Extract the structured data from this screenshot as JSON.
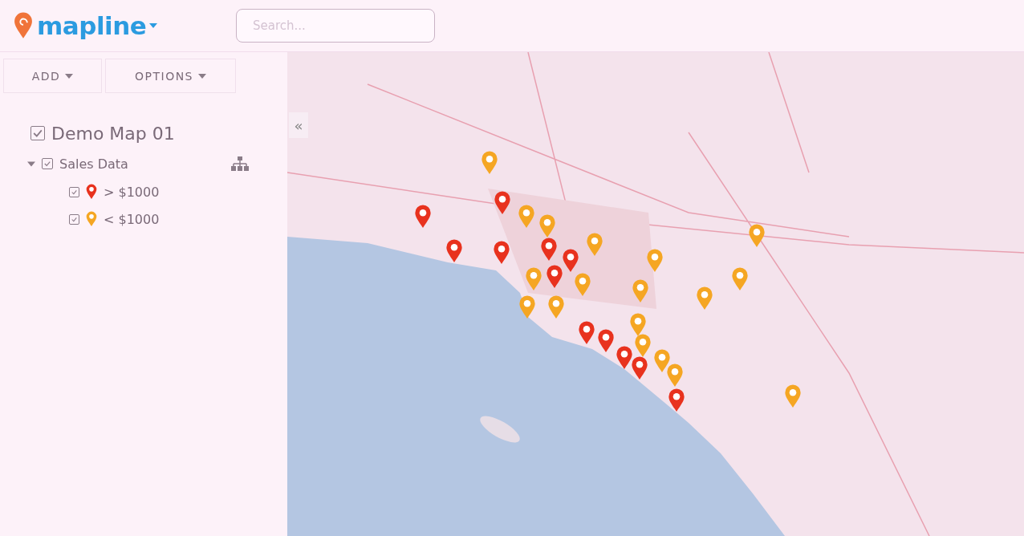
{
  "header": {
    "logo": "mapline",
    "search": {
      "placeholder": "Search..."
    }
  },
  "toolbar": {
    "buttons": [
      "ADD",
      "OPTIONS"
    ]
  },
  "map_tree": {
    "title": "Demo Map 01",
    "checked": true,
    "layers": [
      {
        "name": "Sales Data",
        "checked": true,
        "expanded": true,
        "children": [
          {
            "name": "> $1000",
            "checked": true,
            "color": "#e8321e"
          },
          {
            "name": "< $1000",
            "checked": true,
            "color": "#f5a623"
          }
        ]
      }
    ]
  },
  "map": {
    "collapse_button": "«"
  }
}
